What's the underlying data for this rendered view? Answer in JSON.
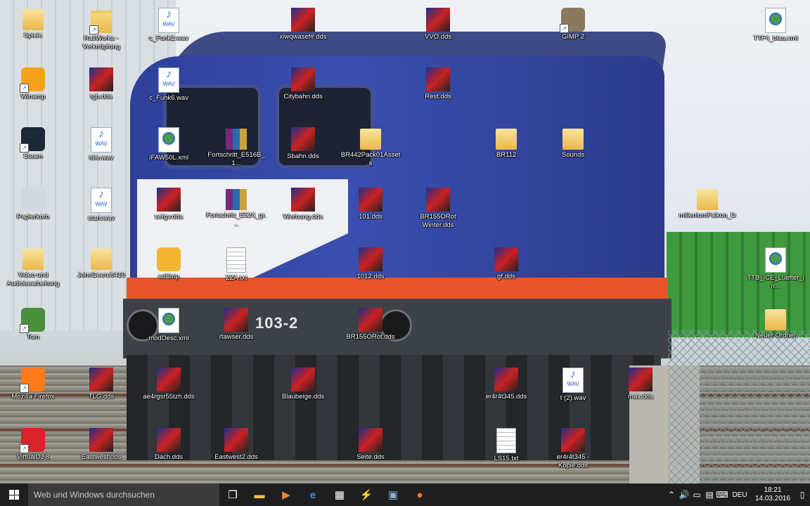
{
  "desktop": {
    "icons": [
      {
        "label": "Spiele",
        "type": "folderdoc",
        "shortcut": false
      },
      {
        "label": "RailWorks - Verknüpfung",
        "type": "folder",
        "shortcut": true
      },
      {
        "label": "c_Funk2.wav",
        "type": "wav",
        "shortcut": false
      },
      {
        "label": "xiwqwasef#.dds",
        "type": "dds",
        "shortcut": false
      },
      {
        "label": "VVO.dds",
        "type": "dds",
        "shortcut": false
      },
      {
        "label": "GIMP 2",
        "type": "app",
        "shortcut": true
      },
      {
        "label": "TTF4_blau.xml",
        "type": "xml",
        "shortcut": false
      },
      {
        "label": "Winamp",
        "type": "app",
        "shortcut": true
      },
      {
        "label": "tgb.dds",
        "type": "dds",
        "shortcut": false
      },
      {
        "label": "c_Funk6.wav",
        "type": "wav",
        "shortcut": false
      },
      {
        "label": "Citybahn.dds",
        "type": "dds",
        "shortcut": false
      },
      {
        "label": "Rest.dds",
        "type": "dds",
        "shortcut": false
      },
      {
        "label": "Steam",
        "type": "app",
        "shortcut": true
      },
      {
        "label": "idle.wav",
        "type": "wav",
        "shortcut": false
      },
      {
        "label": "IFAW50L.xml",
        "type": "xml",
        "shortcut": false
      },
      {
        "label": "Fortschritt_E516B_1...",
        "type": "rar",
        "shortcut": false
      },
      {
        "label": "Sbahn.dds",
        "type": "dds",
        "shortcut": false
      },
      {
        "label": "BR442Pack01Assets",
        "type": "folderdoc",
        "shortcut": false
      },
      {
        "label": "BR112",
        "type": "folderdoc",
        "shortcut": false
      },
      {
        "label": "Sounds",
        "type": "folderdoc",
        "shortcut": false
      },
      {
        "label": "Papierkorb",
        "type": "app",
        "shortcut": false
      },
      {
        "label": "start.wav",
        "type": "wav",
        "shortcut": false
      },
      {
        "label": "sefgv.dds",
        "type": "dds",
        "shortcut": false
      },
      {
        "label": "Fortschritt_E524_gr...",
        "type": "rar",
        "shortcut": false
      },
      {
        "label": "Werbung.dds",
        "type": "dds",
        "shortcut": false
      },
      {
        "label": "101.dds",
        "type": "dds",
        "shortcut": false
      },
      {
        "label": "BR155ORot Winter.dds",
        "type": "dds",
        "shortcut": false
      },
      {
        "label": "milleniumFalkon_D",
        "type": "folderdoc",
        "shortcut": false
      },
      {
        "label": "Video und Audiobearbeitung",
        "type": "folderdoc",
        "shortcut": false
      },
      {
        "label": "JohnDeere8410",
        "type": "folderdoc",
        "shortcut": false
      },
      {
        "label": "adStrip",
        "type": "app",
        "shortcut": false
      },
      {
        "label": "ZZA.txt",
        "type": "txt",
        "shortcut": false
      },
      {
        "label": "1012.dds",
        "type": "dds",
        "shortcut": false
      },
      {
        "label": "gf.dds",
        "type": "dds",
        "shortcut": false
      },
      {
        "label": "TTB_ICE_Luefter_in...",
        "type": "xml",
        "shortcut": false
      },
      {
        "label": "Tom",
        "type": "app",
        "shortcut": true
      },
      {
        "label": "modDesc.xml",
        "type": "xml",
        "shortcut": false
      },
      {
        "label": "rtawser.dds",
        "type": "dds",
        "shortcut": false
      },
      {
        "label": "BR155ORot.dds",
        "type": "dds",
        "shortcut": false
      },
      {
        "label": "Neuer Ordner",
        "type": "folderdoc",
        "shortcut": false
      },
      {
        "label": "Mozilla Firefox",
        "type": "app",
        "shortcut": true
      },
      {
        "label": "TLG.dds",
        "type": "dds",
        "shortcut": false
      },
      {
        "label": "ae4rgsr55tzh.dds",
        "type": "dds",
        "shortcut": false
      },
      {
        "label": "Blaubeige.dds",
        "type": "dds",
        "shortcut": false
      },
      {
        "label": "er4r4t345.dds",
        "type": "dds",
        "shortcut": false
      },
      {
        "label": "t (2).wav",
        "type": "wav",
        "shortcut": false
      },
      {
        "label": "max.dds",
        "type": "dds",
        "shortcut": false
      },
      {
        "label": "VirtualDJ 8",
        "type": "app",
        "shortcut": true
      },
      {
        "label": "Eastwest.dds",
        "type": "dds",
        "shortcut": false
      },
      {
        "label": "Dach.dds",
        "type": "dds",
        "shortcut": false
      },
      {
        "label": "Eastwest2.dds",
        "type": "dds",
        "shortcut": false
      },
      {
        "label": "Seite.dds",
        "type": "dds",
        "shortcut": false
      },
      {
        "label": "LS15.txt",
        "type": "txt",
        "shortcut": false
      },
      {
        "label": "er4r4t345 - Kopie.dds",
        "type": "dds",
        "shortcut": false
      }
    ]
  },
  "wallpaper": {
    "loco_number": "103-2"
  },
  "taskbar": {
    "search_placeholder": "Web und Windows durchsuchen",
    "tray": {
      "language": "DEU",
      "time": "18:21",
      "date": "14.03.2016"
    }
  }
}
